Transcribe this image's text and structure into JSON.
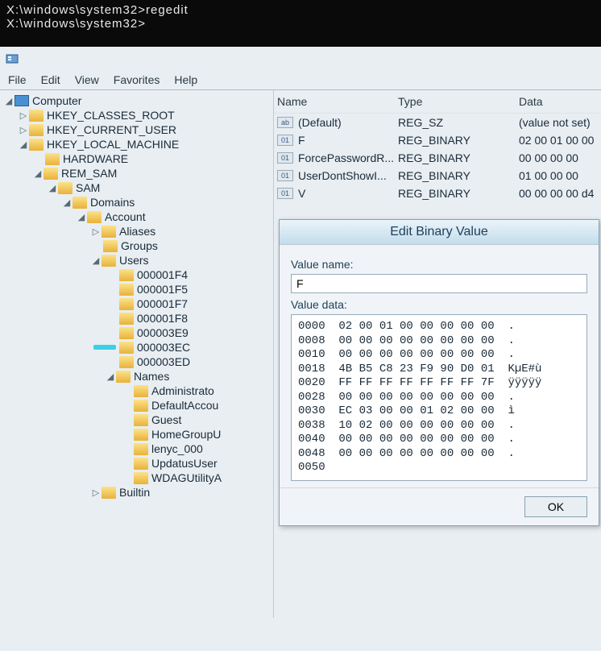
{
  "cmd": {
    "lines": [
      "X:\\windows\\system32>regedit",
      "",
      "X:\\windows\\system32>"
    ]
  },
  "menu": {
    "file": "File",
    "edit": "Edit",
    "view": "View",
    "favorites": "Favorites",
    "help": "Help"
  },
  "tree": {
    "computer": "Computer",
    "hkcr": "HKEY_CLASSES_ROOT",
    "hkcu": "HKEY_CURRENT_USER",
    "hklm": "HKEY_LOCAL_MACHINE",
    "hardware": "HARDWARE",
    "rem_sam": "REM_SAM",
    "sam": "SAM",
    "domains": "Domains",
    "account": "Account",
    "aliases": "Aliases",
    "groups": "Groups",
    "users": "Users",
    "u1": "000001F4",
    "u2": "000001F5",
    "u3": "000001F7",
    "u4": "000001F8",
    "u5": "000003E9",
    "u6": "000003EC",
    "u7": "000003ED",
    "names": "Names",
    "n1": "Administrato",
    "n2": "DefaultAccou",
    "n3": "Guest",
    "n4": "HomeGroupU",
    "n5": "lenyc_000",
    "n6": "UpdatusUser",
    "n7": "WDAGUtilityA",
    "builtin": "Builtin"
  },
  "columns": {
    "name": "Name",
    "type": "Type",
    "data": "Data"
  },
  "rows": [
    {
      "name": "(Default)",
      "type": "REG_SZ",
      "data": "(value not set)",
      "ic": "ab"
    },
    {
      "name": "F",
      "type": "REG_BINARY",
      "data": "02 00 01 00 00",
      "ic": "01"
    },
    {
      "name": "ForcePasswordR...",
      "type": "REG_BINARY",
      "data": "00 00 00 00",
      "ic": "01"
    },
    {
      "name": "UserDontShowI...",
      "type": "REG_BINARY",
      "data": "01 00 00 00",
      "ic": "01"
    },
    {
      "name": "V",
      "type": "REG_BINARY",
      "data": "00 00 00 00 d4",
      "ic": "01"
    }
  ],
  "dialog": {
    "title": "Edit Binary Value",
    "value_name_label": "Value name:",
    "value_name": "F",
    "value_data_label": "Value data:",
    "ok": "OK",
    "hex": "0000  02 00 01 00 00 00 00 00  .\n0008  00 00 00 00 00 00 00 00  .\n0010  00 00 00 00 00 00 00 00  .\n0018  4B B5 C8 23 F9 90 D0 01  KµE#ù\n0020  FF FF FF FF FF FF FF 7F  ÿÿÿÿÿ\n0028  00 00 00 00 00 00 00 00  .\n0030  EC 03 00 00 01 02 00 00  ì\n0038  10 02 00 00 00 00 00 00  .\n0040  00 00 00 00 00 00 00 00  .\n0048  00 00 00 00 00 00 00 00  .\n0050"
  }
}
